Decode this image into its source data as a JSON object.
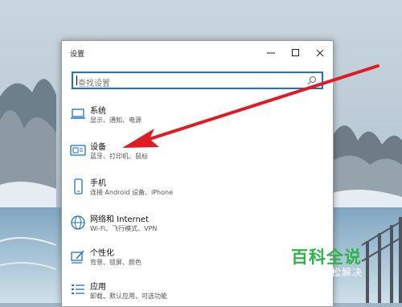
{
  "window": {
    "title": "设置"
  },
  "search": {
    "placeholder": "查找设置"
  },
  "categories": [
    {
      "title": "系统",
      "subtitle": "显示、通知、电源",
      "icon": "laptop-icon"
    },
    {
      "title": "设备",
      "subtitle": "蓝牙、打印机、鼠标",
      "icon": "devices-icon"
    },
    {
      "title": "手机",
      "subtitle": "连接 Android 设备、iPhone",
      "icon": "phone-icon"
    },
    {
      "title": "网络和 Internet",
      "subtitle": "Wi-Fi、飞行模式、VPN",
      "icon": "globe-icon"
    },
    {
      "title": "个性化",
      "subtitle": "背景、锁屏、颜色",
      "icon": "personalize-brush-icon"
    },
    {
      "title": "应用",
      "subtitle": "卸载、默认应用、可选功能",
      "icon": "apps-list-icon"
    }
  ],
  "watermark": {
    "main": "百科全说",
    "sub": "助你轻松解决"
  },
  "colors": {
    "accent": "#1a73c8",
    "arrow": "#e11b22",
    "watermark_green": "#2fb34a"
  }
}
